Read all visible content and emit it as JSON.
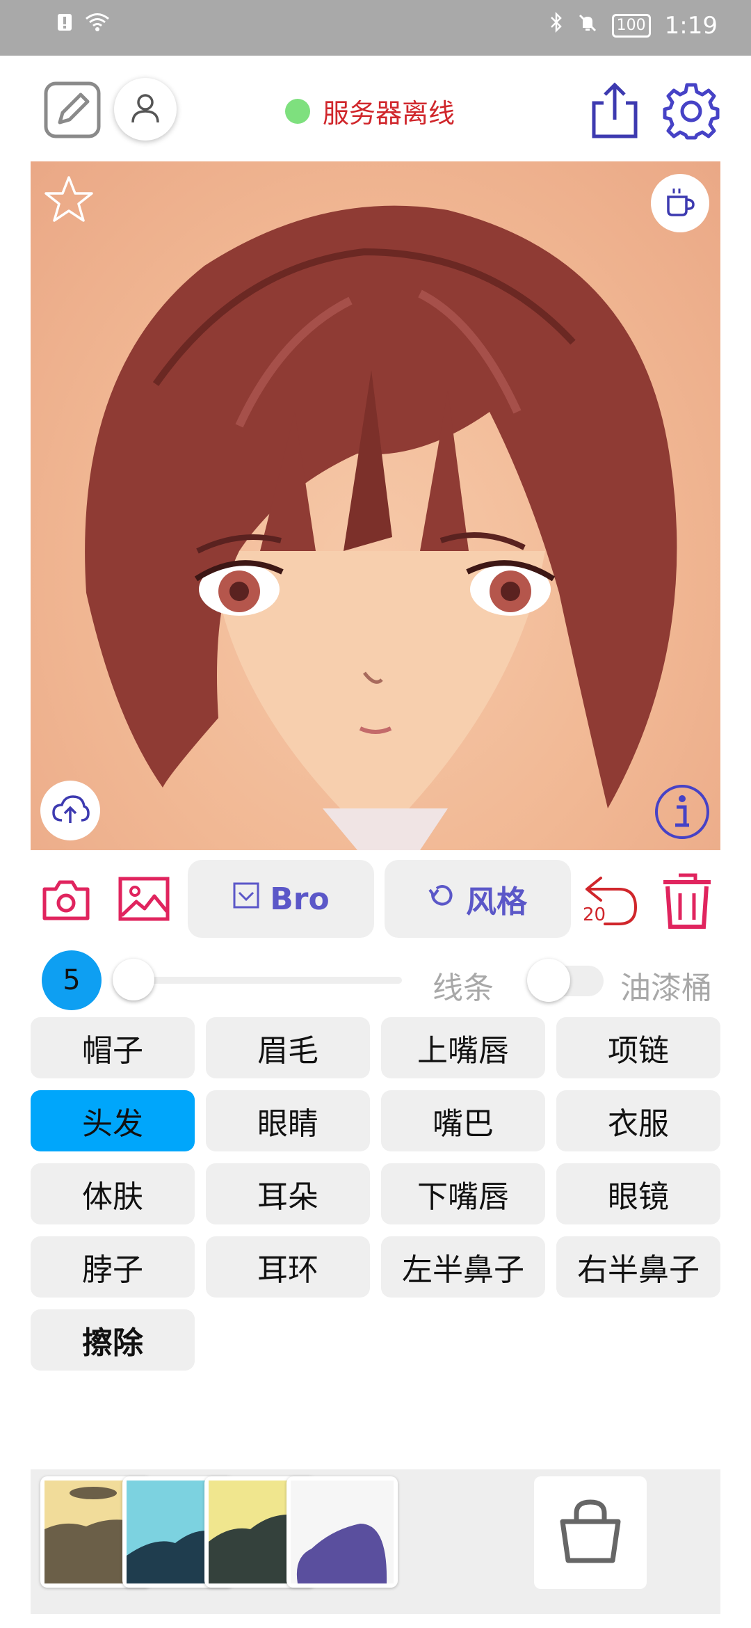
{
  "status_bar": {
    "time": "1:19",
    "battery": "100"
  },
  "toolbar": {
    "server_status": "服务器离线",
    "status_color": "#7ee07e"
  },
  "actions": {
    "bro_label": "Bro",
    "style_label": "风格",
    "undo_count": "20"
  },
  "slider": {
    "brush_size": "5",
    "lines_label": "线条",
    "bucket_label": "油漆桶",
    "bucket_on": false
  },
  "parts": [
    {
      "label": "帽子"
    },
    {
      "label": "眉毛"
    },
    {
      "label": "上嘴唇"
    },
    {
      "label": "项链"
    },
    {
      "label": "头发",
      "selected": true
    },
    {
      "label": "眼睛"
    },
    {
      "label": "嘴巴"
    },
    {
      "label": "衣服"
    },
    {
      "label": "体肤"
    },
    {
      "label": "耳朵"
    },
    {
      "label": "下嘴唇"
    },
    {
      "label": "眼镜"
    },
    {
      "label": "脖子"
    },
    {
      "label": "耳环"
    },
    {
      "label": "左半鼻子"
    },
    {
      "label": "右半鼻子"
    },
    {
      "label": "擦除"
    }
  ],
  "palette": [
    {
      "bg": "#f1dc9a",
      "fg": "#6b5f48"
    },
    {
      "bg": "#7cd2e0",
      "fg": "#1f3d4e"
    },
    {
      "bg": "#f0e68e",
      "fg": "#34413c"
    },
    {
      "bg": "#f6f6f6",
      "fg": "#5a4f9e"
    }
  ],
  "colors": {
    "accent": "#5b57c8",
    "danger": "#d0262b",
    "icon_red": "#e0245e",
    "selected": "#00a6fb"
  }
}
